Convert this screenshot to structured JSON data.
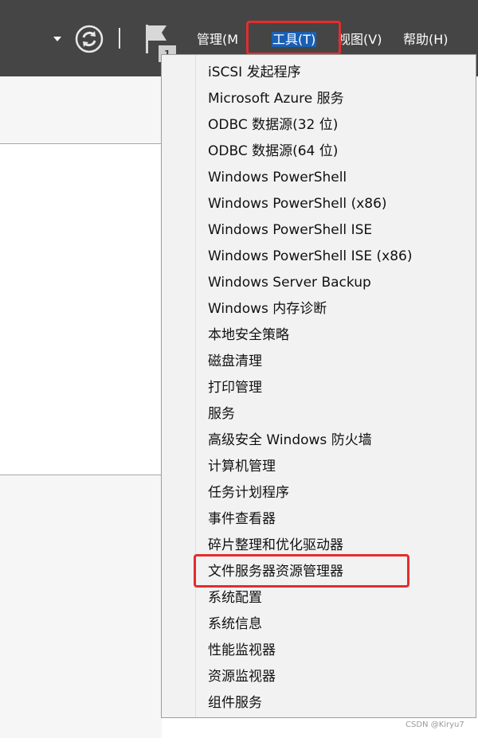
{
  "toolbar": {
    "notification_count": "1",
    "menus": {
      "manage": "管理(M",
      "tools": "工具(T)",
      "view": "视图(V)",
      "help": "帮助(H)"
    }
  },
  "tools_menu": {
    "items": [
      "iSCSI 发起程序",
      "Microsoft Azure 服务",
      "ODBC 数据源(32 位)",
      "ODBC 数据源(64 位)",
      "Windows PowerShell",
      "Windows PowerShell (x86)",
      "Windows PowerShell ISE",
      "Windows PowerShell ISE (x86)",
      "Windows Server Backup",
      "Windows 内存诊断",
      "本地安全策略",
      "磁盘清理",
      "打印管理",
      "服务",
      "高级安全 Windows 防火墙",
      "计算机管理",
      "任务计划程序",
      "事件查看器",
      "碎片整理和优化驱动器",
      "文件服务器资源管理器",
      "系统配置",
      "系统信息",
      "性能监视器",
      "资源监视器",
      "组件服务"
    ]
  },
  "watermark": "CSDN @Kiryu7",
  "colors": {
    "toolbar_bg": "#454545",
    "highlight": "#1a5fb4",
    "annotation_red": "#e32d2d"
  }
}
